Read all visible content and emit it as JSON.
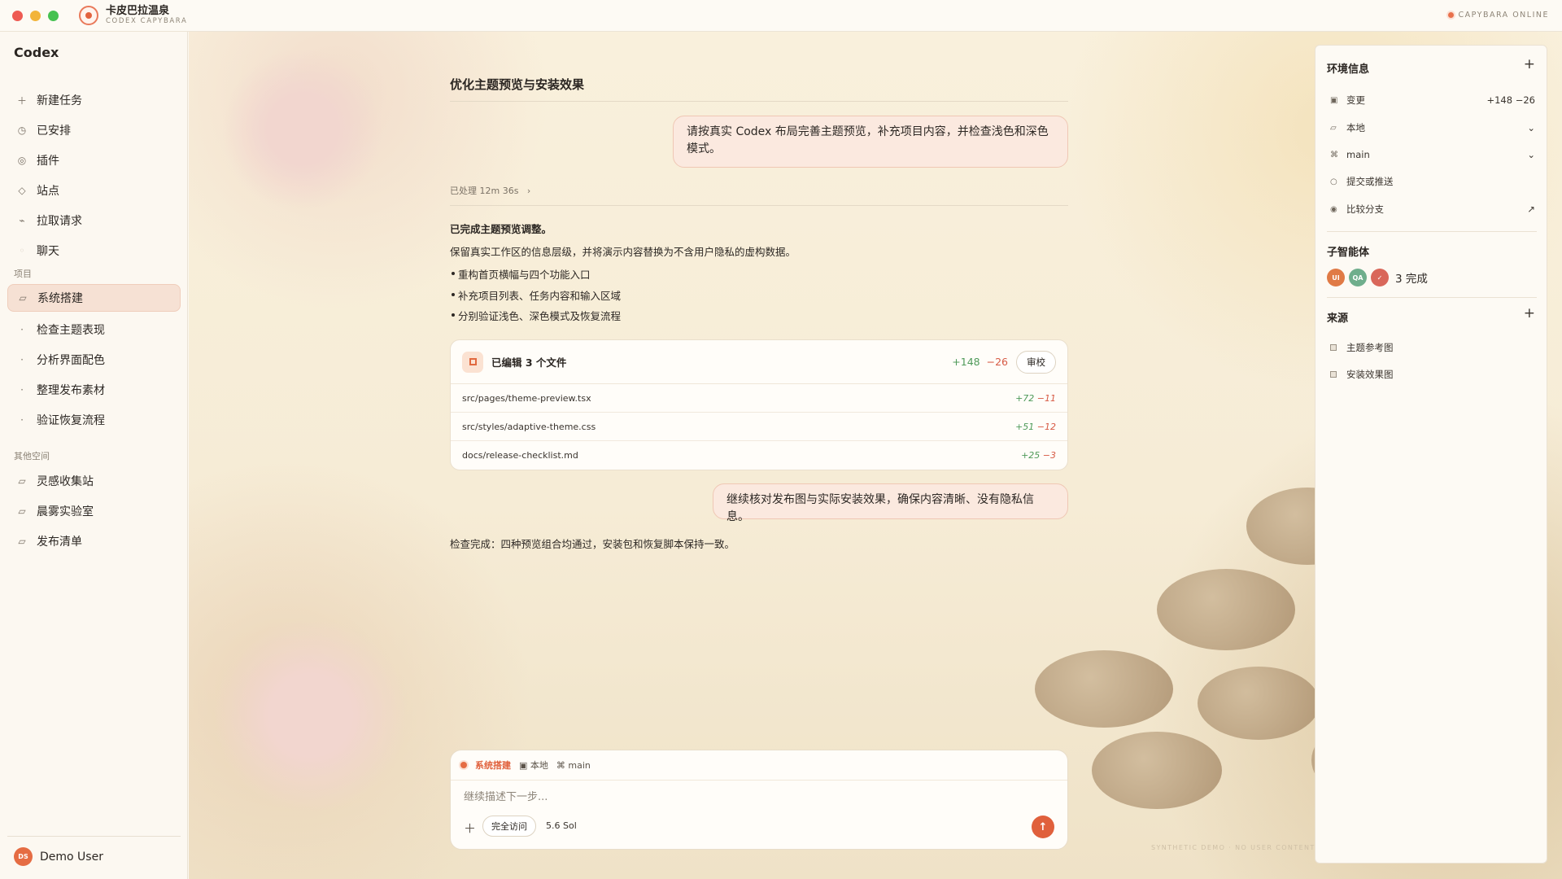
{
  "titlebar": {
    "app_title": "卡皮巴拉温泉",
    "app_subtitle": "CODEX CAPYBARA",
    "status": "CAPYBARA ONLINE"
  },
  "sidebar": {
    "brand": "Codex",
    "nav": [
      {
        "label": "新建任务",
        "icon": "plus-icon"
      },
      {
        "label": "已安排",
        "icon": "clock-icon"
      },
      {
        "label": "插件",
        "icon": "plugin-icon"
      },
      {
        "label": "站点",
        "icon": "diamond-icon"
      },
      {
        "label": "拉取请求",
        "icon": "pull-request-icon"
      },
      {
        "label": "聊天",
        "icon": "chat-icon"
      }
    ],
    "projects_heading": "项目",
    "projects": [
      {
        "label": "系统搭建",
        "active": true
      },
      {
        "label": "检查主题表现"
      },
      {
        "label": "分析界面配色"
      },
      {
        "label": "整理发布素材"
      },
      {
        "label": "验证恢复流程"
      }
    ],
    "other_heading": "其他空间",
    "spaces": [
      {
        "label": "灵感收集站"
      },
      {
        "label": "晨雾实验室"
      },
      {
        "label": "发布清单"
      }
    ],
    "user": {
      "initials": "DS",
      "name": "Demo User"
    }
  },
  "conversation": {
    "title": "优化主题预览与安装效果",
    "user_message_1": "请按真实 Codex 布局完善主题预览，补充项目内容，并检查浅色和深色模式。",
    "processed": "已处理 12m 36s",
    "done_title": "已完成主题预览调整。",
    "summary": "保留真实工作区的信息层级，并将演示内容替换为不含用户隐私的虚构数据。",
    "bullets": [
      "重构首页横幅与四个功能入口",
      "补充项目列表、任务内容和输入区域",
      "分别验证浅色、深色模式及恢复流程"
    ],
    "files_card": {
      "label": "已编辑 3 个文件",
      "added": "+148",
      "removed": "−26",
      "review_button": "审校",
      "files": [
        {
          "path": "src/pages/theme-preview.tsx",
          "added": "+72",
          "removed": "−11"
        },
        {
          "path": "src/styles/adaptive-theme.css",
          "added": "+51",
          "removed": "−12"
        },
        {
          "path": "docs/release-checklist.md",
          "added": "+25",
          "removed": "−3"
        }
      ]
    },
    "user_message_2": "继续核对发布图与实际安装效果，确保内容清晰、没有隐私信息。",
    "final_text": "检查完成：四种预览组合均通过，安装包和恢复脚本保持一致。"
  },
  "composer": {
    "project_tag": "系统搭建",
    "env_tag": "本地",
    "branch_tag": "main",
    "placeholder": "继续描述下一步...",
    "access_button": "完全访问",
    "model": "5.6 Sol"
  },
  "watermark": "SYNTHETIC DEMO · NO USER CONTENT",
  "right_panel": {
    "env_heading": "环境信息",
    "env_rows": [
      {
        "label": "变更",
        "value": "+148 −26",
        "icon": "diff-icon"
      },
      {
        "label": "本地",
        "value": "⌄",
        "icon": "monitor-icon"
      },
      {
        "label": "main",
        "value": "⌄",
        "icon": "branch-icon"
      },
      {
        "label": "提交或推送",
        "value": "",
        "icon": "commit-icon"
      },
      {
        "label": "比较分支",
        "value": "↗",
        "icon": "compare-icon"
      }
    ],
    "agents_heading": "子智能体",
    "agents": [
      {
        "initials": "UI",
        "color": "#e07a45"
      },
      {
        "initials": "QA",
        "color": "#6fae8c"
      },
      {
        "initials": "✓",
        "color": "#d9675a"
      }
    ],
    "agents_status": "3 完成",
    "sources_heading": "来源",
    "sources": [
      "主题参考图",
      "安装效果图"
    ]
  }
}
